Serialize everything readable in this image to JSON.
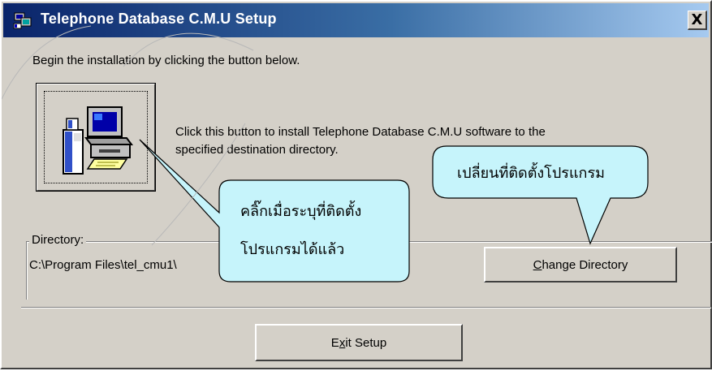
{
  "window": {
    "title": "Telephone Database C.M.U Setup",
    "close_label": "X"
  },
  "instructions": {
    "begin": "Begin the installation by clicking the button below.",
    "click_line1": "Click this button to install Telephone Database C.M.U software to the",
    "click_line2": "specified destination directory."
  },
  "directory": {
    "label": "Directory:",
    "path": "C:\\Program Files\\tel_cmu1\\"
  },
  "buttons": {
    "change_directory": {
      "mnemonic": "C",
      "rest": "hange Directory"
    },
    "exit_setup": {
      "before": "E",
      "mnemonic": "x",
      "after": "it Setup"
    }
  },
  "callouts": {
    "change_dir_note": "เปลี่ยนที่ติดตั้งโปรแกรม",
    "install_note_line1": "คลิ๊กเมื่อระบุที่ติดตั้ง",
    "install_note_line2": "โปรแกรมได้แล้ว"
  },
  "colors": {
    "dialog_face": "#d4d0c8",
    "titlebar_start": "#0a246a",
    "titlebar_end": "#a6caf0",
    "callout_fill": "#c6f4fb"
  },
  "icons": {
    "title_icon": "computer-setup-icon",
    "install_icon": "computer-install-icon"
  }
}
